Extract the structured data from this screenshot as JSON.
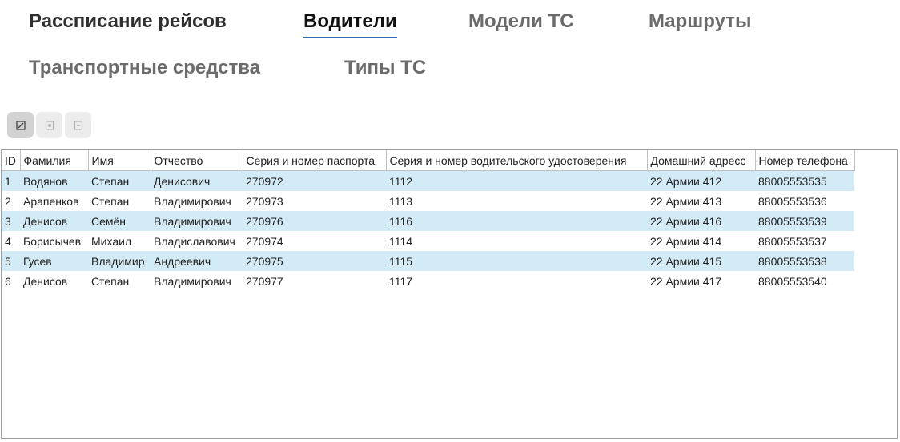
{
  "tabs": [
    "Рассписание рейсов",
    "Водители",
    "Модели ТС",
    "Маршруты",
    "Транспортные средства",
    "Типы ТС"
  ],
  "toolbar": {
    "buttons": [
      "edit-icon",
      "add-icon",
      "delete-icon"
    ]
  },
  "table": {
    "headers": [
      "ID",
      "Фамилия",
      "Имя",
      "Отчество",
      "Серия и номер паспорта",
      "Серия и номер водительского удостоверения",
      "Домашний адресс",
      "Номер телефона"
    ],
    "rows": [
      [
        "1",
        "Водянов",
        "Степан",
        "Денисович",
        "270972",
        "1112",
        "22 Армии 412",
        "88005553535"
      ],
      [
        "2",
        "Арапенков",
        "Степан",
        "Владимирович",
        "270973",
        "1113",
        "22 Армии 413",
        "88005553536"
      ],
      [
        "3",
        "Денисов",
        "Семён",
        "Владимирович",
        "270976",
        "1116",
        "22 Армии 416",
        "88005553539"
      ],
      [
        "4",
        "Борисычев",
        "Михаил",
        "Владиславович",
        "270974",
        "1114",
        "22 Армии 414",
        "88005553537"
      ],
      [
        "5",
        "Гусев",
        "Владимир",
        "Андреевич",
        "270975",
        "1115",
        "22 Армии 415",
        "88005553538"
      ],
      [
        "6",
        "Денисов",
        "Степан",
        "Владимирович",
        "270977",
        "1117",
        "22 Армии 417",
        "88005553540"
      ]
    ]
  },
  "colors": {
    "stripe": "#d3ebf6",
    "active_underline": "#2a6fb0"
  }
}
